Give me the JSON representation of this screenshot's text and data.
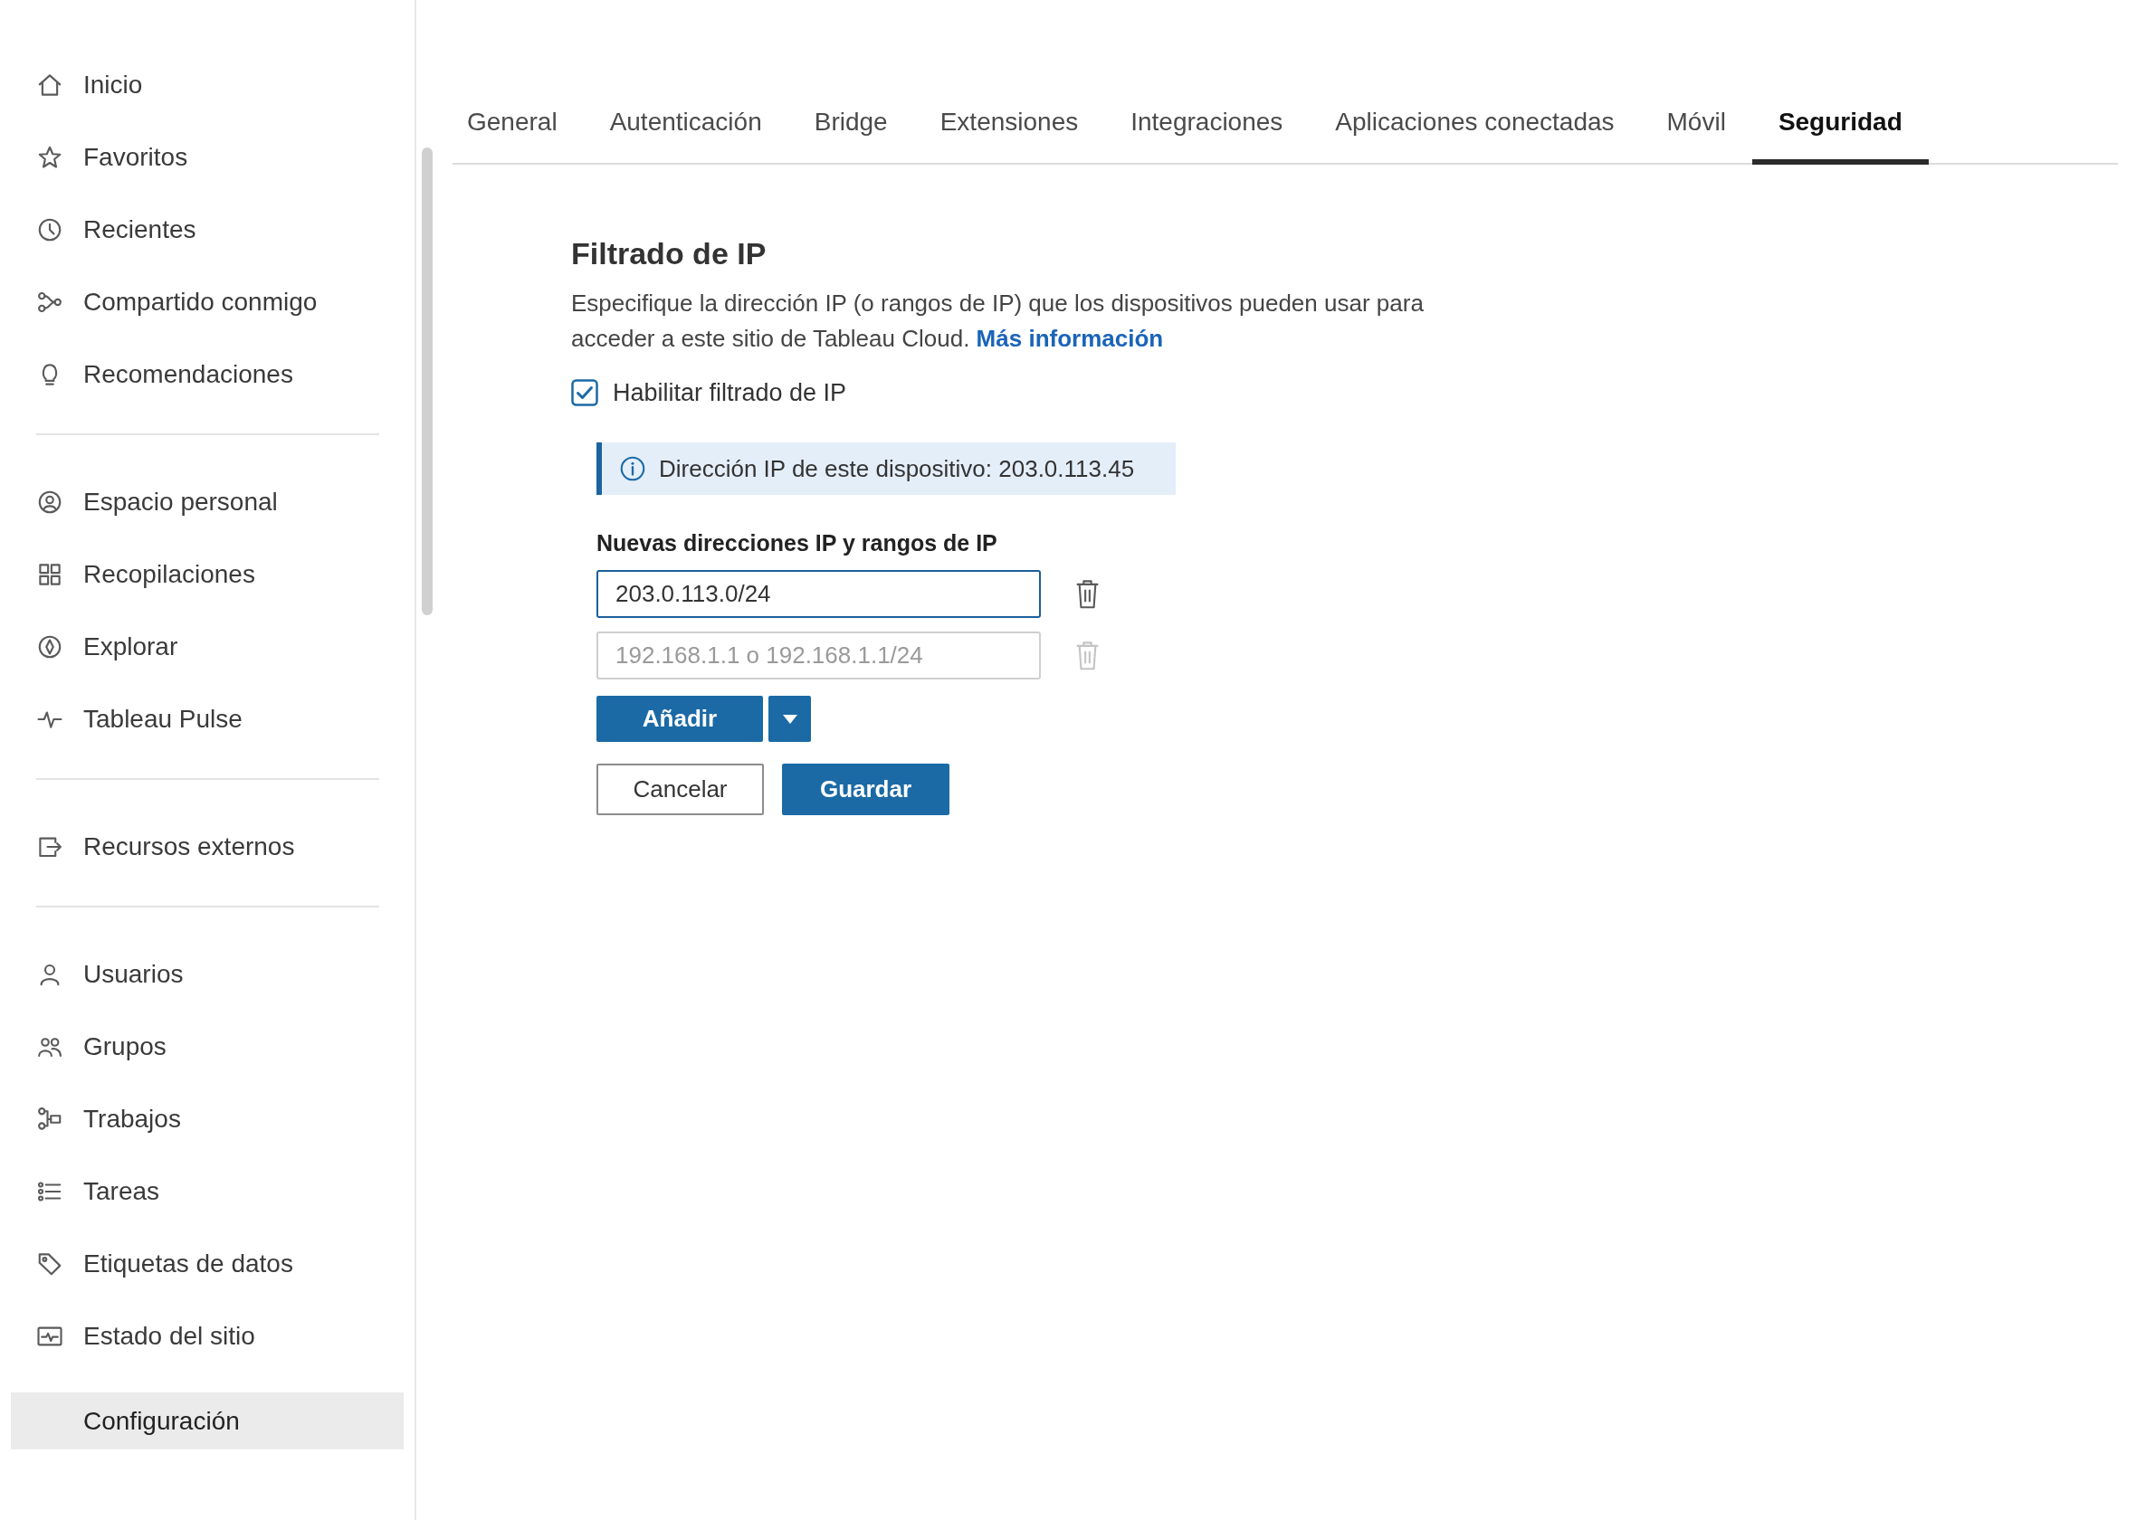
{
  "sidebar": {
    "sections": [
      {
        "items": [
          {
            "label": "Inicio",
            "selected": false
          },
          {
            "label": "Favoritos",
            "selected": false
          },
          {
            "label": "Recientes",
            "selected": false
          },
          {
            "label": "Compartido conmigo",
            "selected": false
          },
          {
            "label": "Recomendaciones",
            "selected": false
          }
        ]
      },
      {
        "items": [
          {
            "label": "Espacio personal",
            "selected": false
          },
          {
            "label": "Recopilaciones",
            "selected": false
          },
          {
            "label": "Explorar",
            "selected": false
          },
          {
            "label": "Tableau Pulse",
            "selected": false
          }
        ]
      },
      {
        "items": [
          {
            "label": "Recursos externos",
            "selected": false
          }
        ]
      },
      {
        "items": [
          {
            "label": "Usuarios",
            "selected": false
          },
          {
            "label": "Grupos",
            "selected": false
          },
          {
            "label": "Trabajos",
            "selected": false
          },
          {
            "label": "Tareas",
            "selected": false
          },
          {
            "label": "Etiquetas de datos",
            "selected": false
          },
          {
            "label": "Estado del sitio",
            "selected": false
          },
          {
            "label": "Configuración",
            "selected": true
          }
        ]
      }
    ]
  },
  "tabs": [
    {
      "label": "General",
      "selected": false
    },
    {
      "label": "Autenticación",
      "selected": false
    },
    {
      "label": "Bridge",
      "selected": false
    },
    {
      "label": "Extensiones",
      "selected": false
    },
    {
      "label": "Integraciones",
      "selected": false
    },
    {
      "label": "Aplicaciones conectadas",
      "selected": false
    },
    {
      "label": "Móvil",
      "selected": false
    },
    {
      "label": "Seguridad",
      "selected": true
    }
  ],
  "ip_filtering": {
    "title": "Filtrado de IP",
    "description": "Especifique la dirección IP (o rangos de IP) que los dispositivos pueden usar para acceder a este sitio de Tableau Cloud.",
    "link": "Más información",
    "enable_checkbox": {
      "label": "Habilitar filtrado de IP",
      "checked": true
    },
    "info_banner": "Dirección IP de este dispositivo: 203.0.113.45",
    "field_label": "Nuevas direcciones IP y rangos de IP",
    "entries": [
      {
        "value": "203.0.113.0/24",
        "focused": true,
        "delete_disabled": false
      },
      {
        "placeholder": "192.168.1.1 o 192.168.1.1/24",
        "focused": false,
        "delete_disabled": true
      }
    ],
    "add_button": "Añadir",
    "buttons": [
      {
        "label": "Cancelar",
        "kind": "secondary"
      },
      {
        "label": "Guardar",
        "kind": "primary"
      }
    ]
  }
}
